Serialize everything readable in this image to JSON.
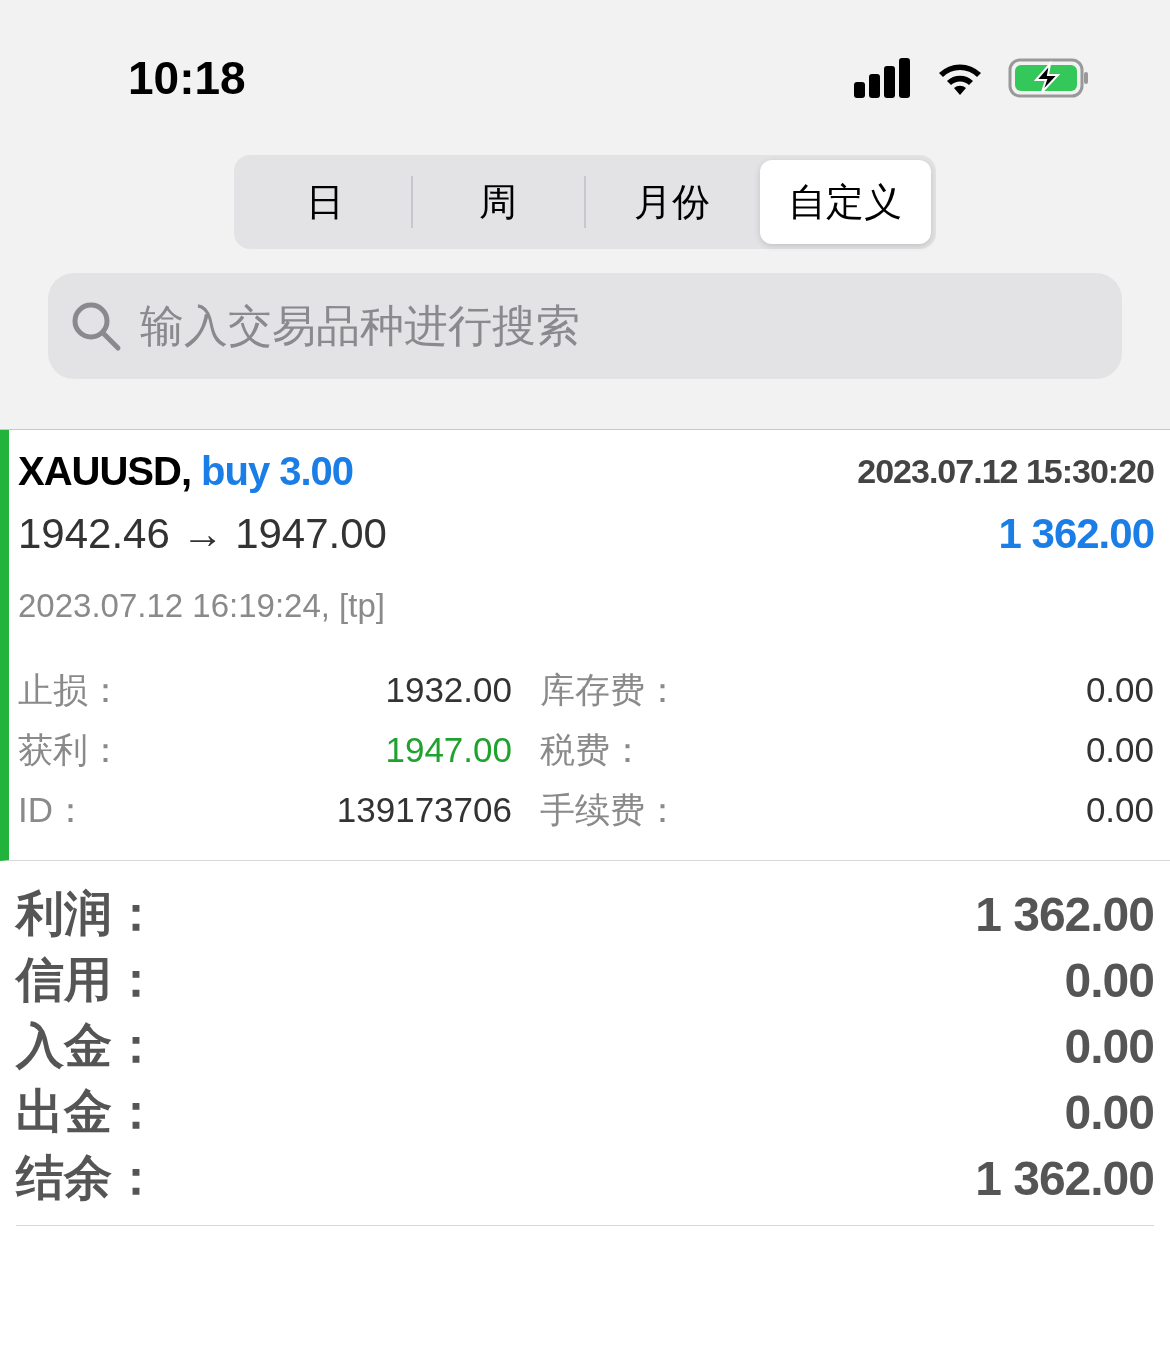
{
  "status_bar": {
    "time": "10:18"
  },
  "segments": [
    {
      "label": "日",
      "selected": false
    },
    {
      "label": "周",
      "selected": false
    },
    {
      "label": "月份",
      "selected": false
    },
    {
      "label": "自定义",
      "selected": true
    }
  ],
  "search": {
    "placeholder": "输入交易品种进行搜索"
  },
  "trade": {
    "symbol": "XAUUSD,",
    "side": "buy 3.00",
    "open_time": "2023.07.12 15:30:20",
    "prices": "1942.46 → 1947.00",
    "profit": "1 362.00",
    "close_info": "2023.07.12 16:19:24, [tp]",
    "details": [
      {
        "label": "止损：",
        "value": "1932.00",
        "color": "#333333"
      },
      {
        "label": "库存费：",
        "value": "0.00",
        "color": "#333333"
      },
      {
        "label": "获利：",
        "value": "1947.00",
        "color": "#1fa22e"
      },
      {
        "label": "税费：",
        "value": "0.00",
        "color": "#333333"
      },
      {
        "label": "ID：",
        "value": "139173706",
        "color": "#333333"
      },
      {
        "label": "手续费：",
        "value": "0.00",
        "color": "#333333"
      }
    ]
  },
  "summary": [
    {
      "label": "利润：",
      "value": "1 362.00"
    },
    {
      "label": "信用：",
      "value": "0.00"
    },
    {
      "label": "入金：",
      "value": "0.00"
    },
    {
      "label": "出金：",
      "value": "0.00"
    },
    {
      "label": "结余：",
      "value": "1 362.00"
    }
  ]
}
